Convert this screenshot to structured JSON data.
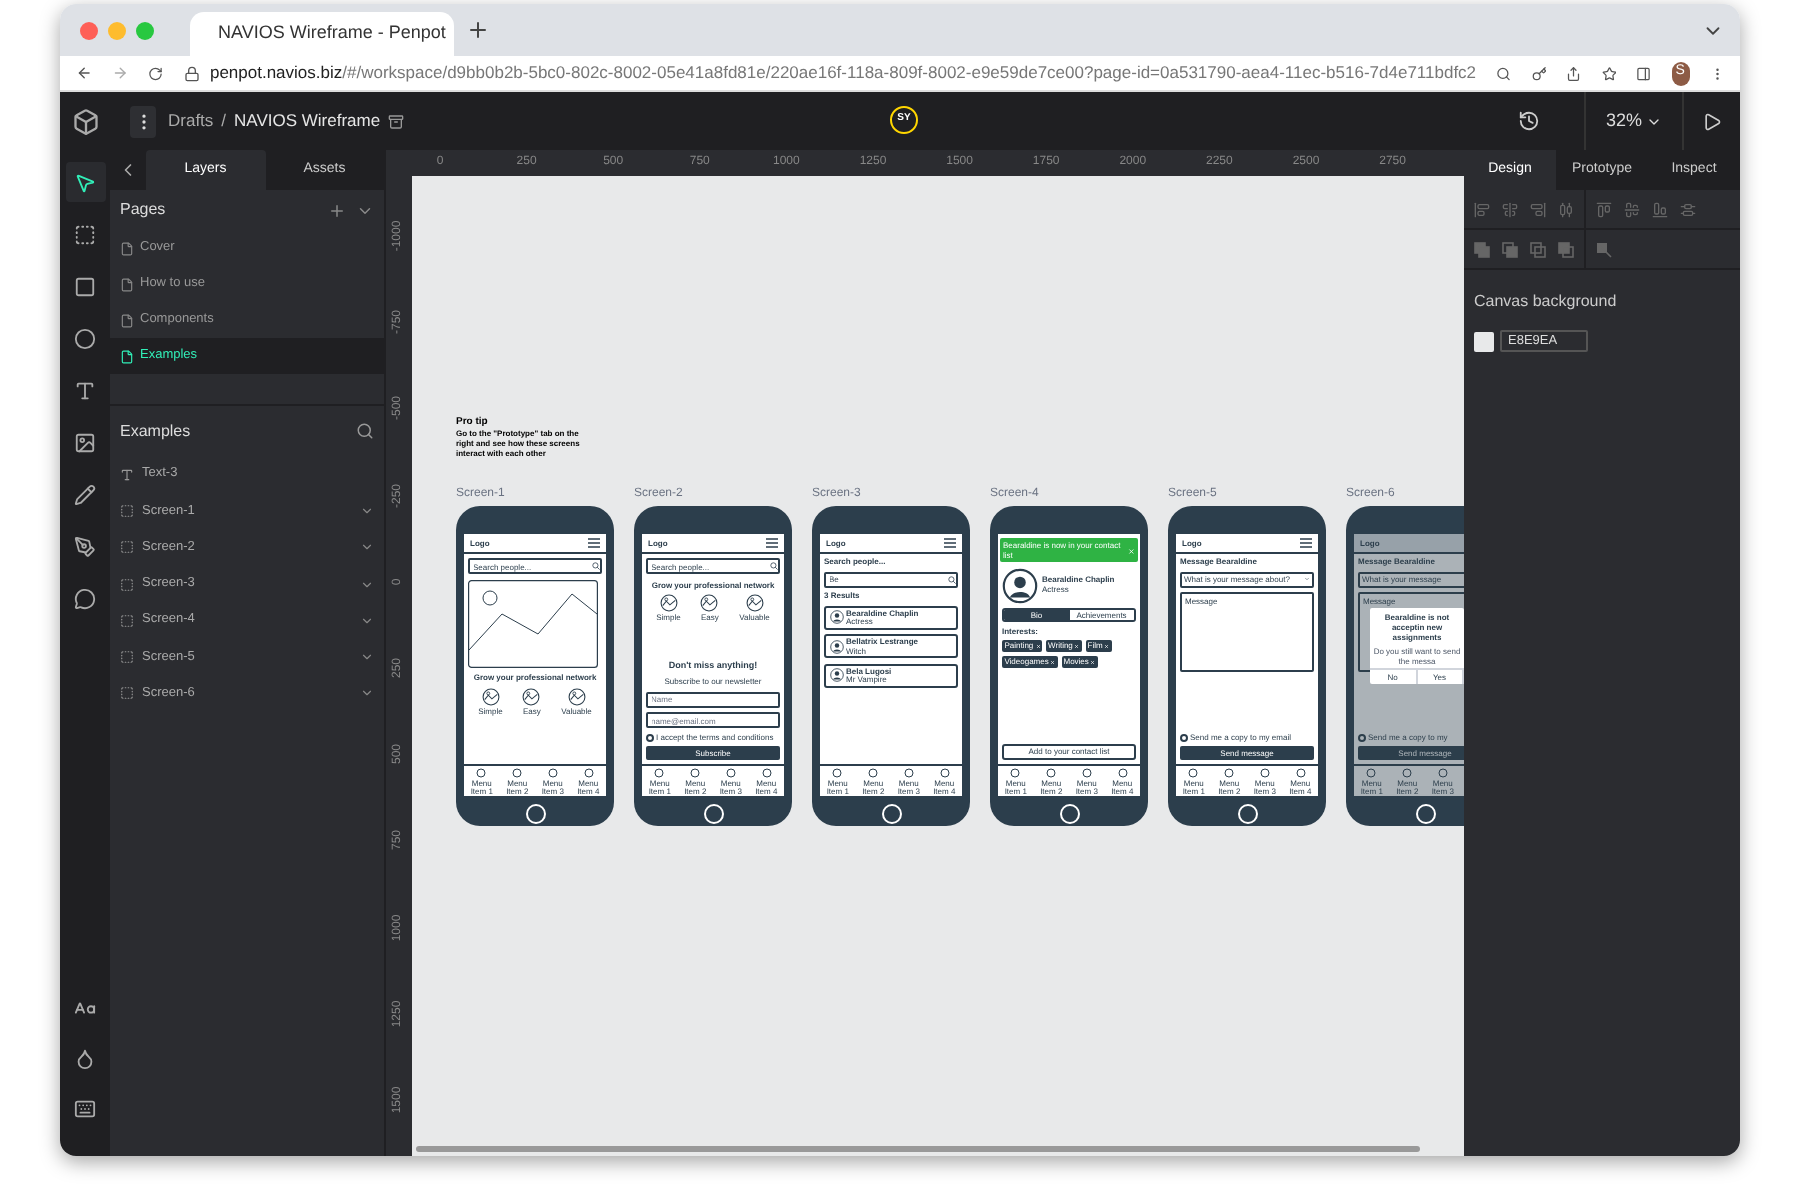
{
  "browser": {
    "tab_title": "NAVIOS Wireframe - Penpot",
    "url_host": "penpot.navios.biz",
    "url_path": "/#/workspace/d9bb0b2b-5bc0-802c-8002-05e41a8fd81e/220ae16f-118a-809f-8002-e9e59de7ce00?page-id=0a531790-aea4-11ec-b516-7d4e711bdfc2",
    "profile_initial": "S"
  },
  "toolbar": {
    "breadcrumb": "Drafts",
    "separator": "/",
    "file_name": "NAVIOS Wireframe",
    "user_initials": "SY",
    "zoom": "32%"
  },
  "tools": [
    {
      "kind": "move",
      "selected": true
    },
    {
      "kind": "board",
      "selected": false
    },
    {
      "kind": "rect",
      "selected": false
    },
    {
      "kind": "ellipse",
      "selected": false
    },
    {
      "kind": "text",
      "selected": false
    },
    {
      "kind": "image",
      "selected": false
    },
    {
      "kind": "pencil",
      "selected": false
    },
    {
      "kind": "path",
      "selected": false
    },
    {
      "kind": "comment",
      "selected": false
    }
  ],
  "bottom_tools": [
    {
      "kind": "typography"
    },
    {
      "kind": "color"
    },
    {
      "kind": "shortcuts"
    }
  ],
  "sidebar": {
    "tabs": [
      {
        "label": "Layers",
        "selected": true
      },
      {
        "label": "Assets",
        "selected": false
      }
    ],
    "pages": {
      "title": "Pages",
      "items": [
        {
          "label": "Cover",
          "selected": false
        },
        {
          "label": "How to use",
          "selected": false
        },
        {
          "label": "Components",
          "selected": false
        },
        {
          "label": "Examples",
          "selected": true
        }
      ]
    },
    "layers": {
      "title": "Examples",
      "items": [
        {
          "label": "Text-3",
          "kind": "text"
        },
        {
          "label": "Screen-1",
          "kind": "board"
        },
        {
          "label": "Screen-2",
          "kind": "board"
        },
        {
          "label": "Screen-3",
          "kind": "board"
        },
        {
          "label": "Screen-4",
          "kind": "board"
        },
        {
          "label": "Screen-5",
          "kind": "board"
        },
        {
          "label": "Screen-6",
          "kind": "board"
        }
      ]
    }
  },
  "rulers": {
    "horizontal": [
      "0",
      "250",
      "500",
      "750",
      "1000",
      "1250",
      "1500",
      "1750",
      "2000",
      "2250",
      "2500",
      "2750"
    ],
    "vertical": [
      "-1000",
      "-750",
      "-500",
      "-250",
      "0",
      "250",
      "500",
      "750",
      "1000",
      "1250",
      "1500"
    ]
  },
  "canvas": {
    "pro_tip": {
      "title": "Pro tip",
      "text": "Go to the \"Prototype\" tab on the right and see how these screens interact with each other"
    },
    "screens": [
      {
        "label": "Screen-1",
        "logo": "Logo",
        "nav": [
          "Menu Item 1",
          "Menu Item 2",
          "Menu Item 3",
          "Menu Item 4"
        ],
        "blocks": [
          {
            "kind": "search",
            "placeholder": "Search people..."
          },
          {
            "kind": "image"
          },
          {
            "kind": "heading",
            "text": "Grow your professional network"
          },
          {
            "kind": "features",
            "items": [
              "Simple",
              "Easy",
              "Valuable"
            ]
          }
        ]
      },
      {
        "label": "Screen-2",
        "logo": "Logo",
        "nav": [
          "Menu Item 1",
          "Menu Item 2",
          "Menu Item 3",
          "Menu Item 4"
        ],
        "blocks": [
          {
            "kind": "search",
            "placeholder": "Search people..."
          },
          {
            "kind": "heading",
            "text": "Grow your professional network"
          },
          {
            "kind": "features",
            "items": [
              "Simple",
              "Easy",
              "Valuable"
            ]
          },
          {
            "kind": "spacer"
          },
          {
            "kind": "title",
            "text": "Don't miss anything!"
          },
          {
            "kind": "note",
            "text": "Subscribe to our newsletter"
          },
          {
            "kind": "input",
            "placeholder": "Name"
          },
          {
            "kind": "input",
            "placeholder": "name@email.com"
          },
          {
            "kind": "checkbox",
            "label": "I accept the terms and conditions",
            "checked": false
          },
          {
            "kind": "button",
            "label": "Subscribe"
          }
        ]
      },
      {
        "label": "Screen-3",
        "logo": "Logo",
        "nav": [
          "Menu Item 1",
          "Menu Item 2",
          "Menu Item 3",
          "Menu Item 4"
        ],
        "blocks": [
          {
            "kind": "label",
            "text": "Search people..."
          },
          {
            "kind": "search",
            "value": "Be"
          },
          {
            "kind": "label",
            "text": "3 Results"
          },
          {
            "kind": "result",
            "name": "Bearaldine Chaplin",
            "role": "Actress"
          },
          {
            "kind": "result",
            "name": "Bellatrix Lestrange",
            "role": "Witch"
          },
          {
            "kind": "result",
            "name": "Bela Lugosi",
            "role": "Mr Vampire"
          }
        ]
      },
      {
        "label": "Screen-4",
        "nav": [
          "Menu Item 1",
          "Menu Item 2",
          "Menu Item 3",
          "Menu Item 4"
        ],
        "blocks": [
          {
            "kind": "banner",
            "text": "Bearaldine is now in your contact list"
          },
          {
            "kind": "profile",
            "name": "Bearaldine Chaplin",
            "role": "Actress"
          },
          {
            "kind": "toggle",
            "options": [
              {
                "label": "Bio",
                "selected": true
              },
              {
                "label": "Achievements",
                "selected": false
              }
            ]
          },
          {
            "kind": "label",
            "text": "Interests:"
          },
          {
            "kind": "tags",
            "items": [
              "Painting",
              "Writing",
              "Film",
              "Videogames",
              "Movies"
            ]
          },
          {
            "kind": "spacer"
          },
          {
            "kind": "outline_button",
            "label": "Add to your contact list"
          }
        ]
      },
      {
        "label": "Screen-5",
        "logo": "Logo",
        "nav": [
          "Menu Item 1",
          "Menu Item 2",
          "Menu Item 3",
          "Menu Item 4"
        ],
        "blocks": [
          {
            "kind": "label",
            "text": "Message Bearaldine"
          },
          {
            "kind": "select",
            "value": "What is your message about?"
          },
          {
            "kind": "textarea",
            "placeholder": "Message"
          },
          {
            "kind": "spacer"
          },
          {
            "kind": "checkbox",
            "label": "Send me a copy to my email",
            "checked": false
          },
          {
            "kind": "button",
            "label": "Send message"
          }
        ]
      },
      {
        "label": "Screen-6",
        "logo": "Logo",
        "dimmed": true,
        "nav": [
          "Menu Item 1",
          "Menu Item 2",
          "Menu Item 3"
        ],
        "modal": {
          "title": "Bearaldine is not acceptin new assignments",
          "text": "Do you still want to send the messa",
          "buttons": [
            "No",
            "Yes"
          ]
        },
        "blocks": [
          {
            "kind": "label",
            "text": "Message Bearaldine"
          },
          {
            "kind": "select",
            "value": "What is your message"
          },
          {
            "kind": "textarea",
            "placeholder": "Message"
          },
          {
            "kind": "spacer"
          },
          {
            "kind": "checkbox",
            "label": "Send me a copy to my",
            "checked": false
          },
          {
            "kind": "button",
            "label": "Send message"
          }
        ]
      }
    ]
  },
  "design_panel": {
    "tabs": [
      {
        "label": "Design",
        "selected": true
      },
      {
        "label": "Prototype",
        "selected": false
      },
      {
        "label": "Inspect",
        "selected": false
      }
    ],
    "canvas_background": {
      "label": "Canvas background",
      "value": "E8E9EA"
    }
  }
}
